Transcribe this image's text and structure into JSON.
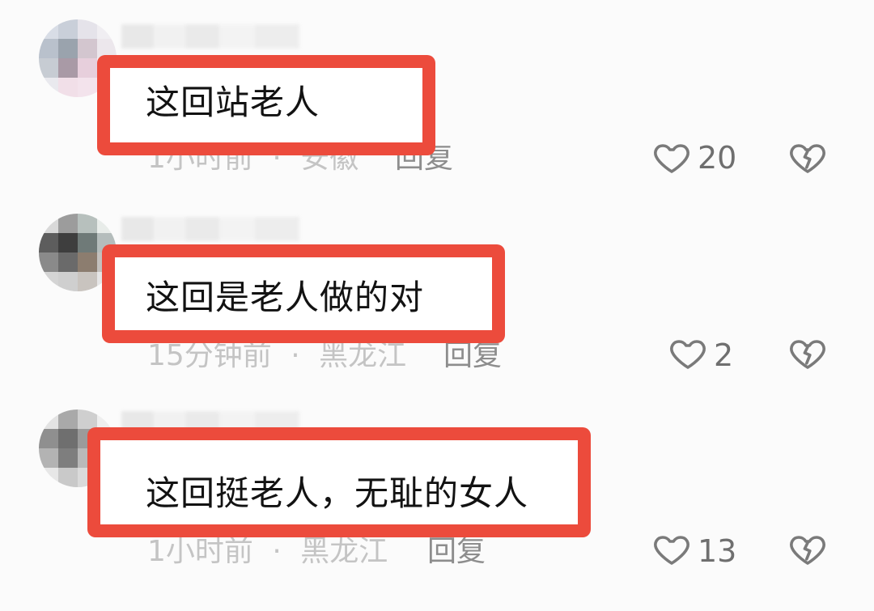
{
  "comments": [
    {
      "text": "这回站老人",
      "time": "1小时前",
      "location": "安徽",
      "reply_label": "回复",
      "likes": "20"
    },
    {
      "text": "这回是老人做的对",
      "time": "15分钟前",
      "location": "黑龙江",
      "reply_label": "回复",
      "likes": "2"
    },
    {
      "text": "这回挺老人，无耻的女人",
      "time": "1小时前",
      "location": "黑龙江",
      "reply_label": "回复",
      "likes": "13"
    }
  ],
  "separator": "·",
  "icons": {
    "like": "heart-outline-icon",
    "dislike": "broken-heart-icon"
  },
  "colors": {
    "highlight": "#ec4b3c",
    "meta_text": "#c4c4c4",
    "icon": "#7a7a7a"
  }
}
